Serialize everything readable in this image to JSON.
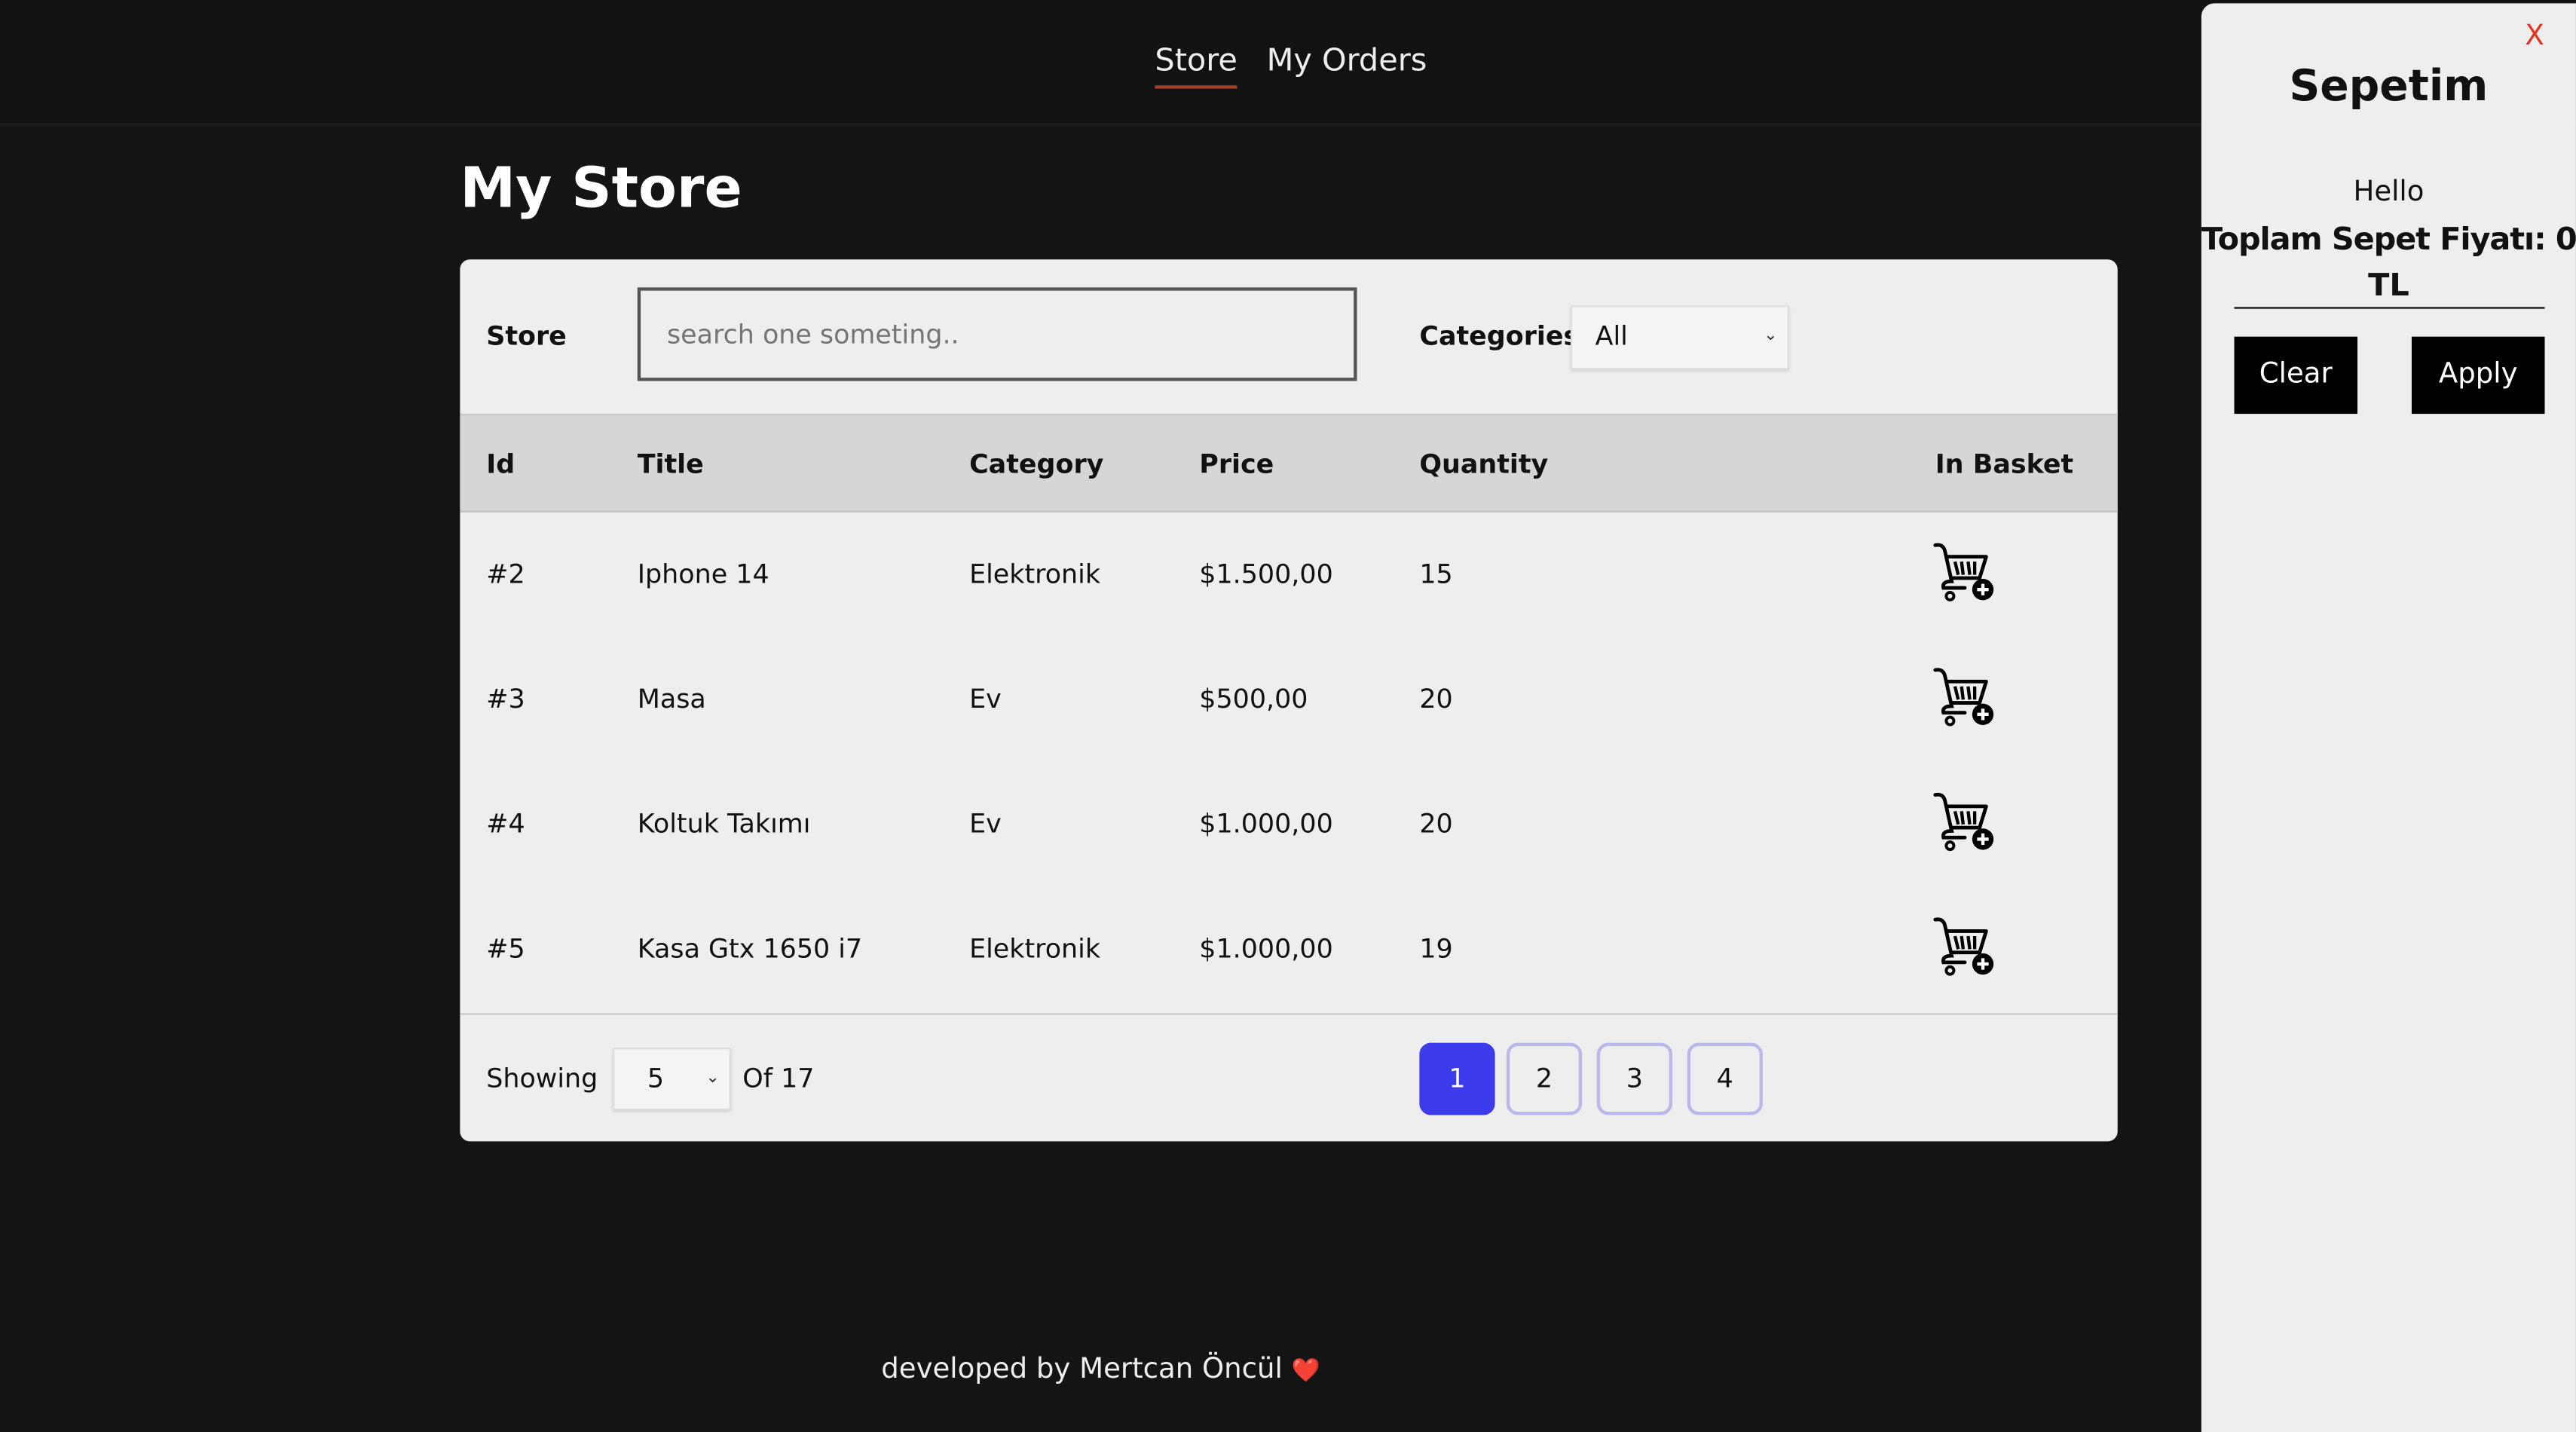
{
  "nav": {
    "items": [
      {
        "label": "Store",
        "active": true
      },
      {
        "label": "My Orders",
        "active": false
      }
    ]
  },
  "page_title": "My Store",
  "filters": {
    "store_label": "Store",
    "search_placeholder": "search one someting..",
    "search_value": "",
    "categories_label": "Categories",
    "category_selected": "All"
  },
  "table": {
    "headers": [
      "Id",
      "Title",
      "Category",
      "Price",
      "Quantity",
      "In Basket"
    ],
    "rows": [
      {
        "id": "#2",
        "title": "Iphone 14",
        "category": "Elektronik",
        "price": "$1.500,00",
        "quantity": "15",
        "basket_icon": "cart-add-icon"
      },
      {
        "id": "#3",
        "title": "Masa",
        "category": "Ev",
        "price": "$500,00",
        "quantity": "20",
        "basket_icon": "cart-add-icon"
      },
      {
        "id": "#4",
        "title": "Koltuk Takımı",
        "category": "Ev",
        "price": "$1.000,00",
        "quantity": "20",
        "basket_icon": "cart-add-icon"
      },
      {
        "id": "#5",
        "title": "Kasa Gtx 1650 i7",
        "category": "Elektronik",
        "price": "$1.000,00",
        "quantity": "19",
        "basket_icon": "cart-add-icon"
      }
    ]
  },
  "pagination": {
    "showing_label": "Showing",
    "page_size": "5",
    "of_label": "Of 17",
    "pages": [
      "1",
      "2",
      "3",
      "4"
    ],
    "current_page": "1"
  },
  "footer": {
    "text": "developed by Mertcan Öncül",
    "heart": "❤️"
  },
  "basket": {
    "close": "X",
    "title": "Sepetim",
    "greeting": "Hello",
    "total_line1": "Toplam Sepet Fiyatı: 0",
    "total_line2": "TL",
    "clear_label": "Clear",
    "apply_label": "Apply"
  },
  "colors": {
    "accent": "#3c3cec",
    "nav_underline": "#a0412a",
    "close": "#e8321e",
    "background": "#141414",
    "card": "#eeeeee"
  }
}
